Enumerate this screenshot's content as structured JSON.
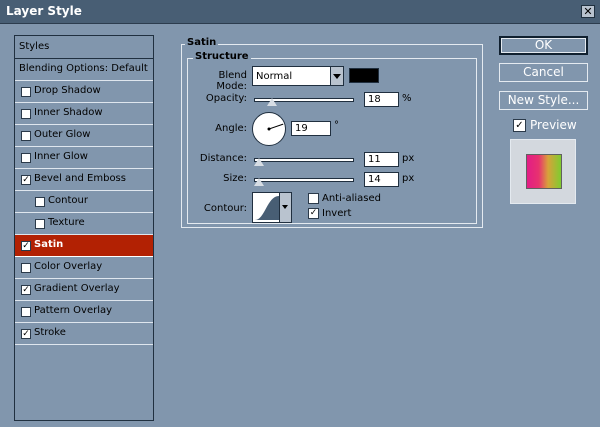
{
  "window": {
    "title": "Layer Style",
    "close_glyph": "✕"
  },
  "styles_panel": {
    "header": "Styles",
    "items": [
      {
        "label": "Blending Options: Default",
        "checkbox": false,
        "checked": false,
        "indent": 0,
        "selected": false
      },
      {
        "label": "Drop Shadow",
        "checkbox": true,
        "checked": false,
        "indent": 0,
        "selected": false
      },
      {
        "label": "Inner Shadow",
        "checkbox": true,
        "checked": false,
        "indent": 0,
        "selected": false
      },
      {
        "label": "Outer Glow",
        "checkbox": true,
        "checked": false,
        "indent": 0,
        "selected": false
      },
      {
        "label": "Inner Glow",
        "checkbox": true,
        "checked": false,
        "indent": 0,
        "selected": false
      },
      {
        "label": "Bevel and Emboss",
        "checkbox": true,
        "checked": true,
        "indent": 0,
        "selected": false
      },
      {
        "label": "Contour",
        "checkbox": true,
        "checked": false,
        "indent": 1,
        "selected": false
      },
      {
        "label": "Texture",
        "checkbox": true,
        "checked": false,
        "indent": 1,
        "selected": false
      },
      {
        "label": "Satin",
        "checkbox": true,
        "checked": true,
        "indent": 0,
        "selected": true
      },
      {
        "label": "Color Overlay",
        "checkbox": true,
        "checked": false,
        "indent": 0,
        "selected": false
      },
      {
        "label": "Gradient Overlay",
        "checkbox": true,
        "checked": true,
        "indent": 0,
        "selected": false
      },
      {
        "label": "Pattern Overlay",
        "checkbox": true,
        "checked": false,
        "indent": 0,
        "selected": false
      },
      {
        "label": "Stroke",
        "checkbox": true,
        "checked": true,
        "indent": 0,
        "selected": false
      }
    ],
    "check_glyph": "✓"
  },
  "satin": {
    "title": "Satin",
    "structure_title": "Structure",
    "blend_mode": {
      "label": "Blend Mode:",
      "value": "Normal"
    },
    "color": "#000000",
    "opacity": {
      "label": "Opacity:",
      "value": "18",
      "unit": "%",
      "level": 0.18
    },
    "angle": {
      "label": "Angle:",
      "value": "19",
      "unit": "°",
      "degrees": 19
    },
    "distance": {
      "label": "Distance:",
      "value": "11",
      "unit": "px",
      "level": 0.05
    },
    "size": {
      "label": "Size:",
      "value": "14",
      "unit": "px",
      "level": 0.05
    },
    "contour": {
      "label": "Contour:"
    },
    "anti_aliased": {
      "label": "Anti-aliased",
      "checked": false
    },
    "invert": {
      "label": "Invert",
      "checked": true
    }
  },
  "buttons": {
    "ok": "OK",
    "cancel": "Cancel",
    "new_style": "New Style..."
  },
  "preview": {
    "label": "Preview",
    "checked": true,
    "check_glyph": "✓"
  },
  "colors": {
    "accent_selected": "#b22103",
    "background": "#8196ad",
    "titlebar": "#485e74"
  }
}
